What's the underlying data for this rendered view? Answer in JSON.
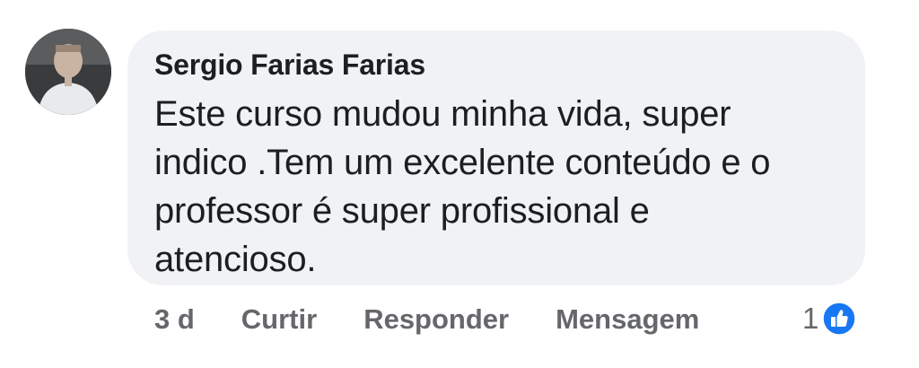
{
  "comment": {
    "author": "Sergio Farias Farias",
    "text": "Este curso mudou minha vida, super indico .Tem um excelente conteúdo e o professor é super profissional e atencioso."
  },
  "actions": {
    "time": "3 d",
    "like_label": "Curtir",
    "reply_label": "Responder",
    "message_label": "Mensagem"
  },
  "reactions": {
    "count": "1",
    "icon": "like-icon",
    "color": "#1877f2"
  }
}
